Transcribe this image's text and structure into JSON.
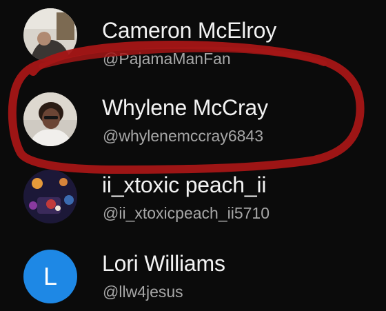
{
  "colors": {
    "background": "#0b0b0b",
    "name_text": "#f2f2f2",
    "handle_text": "#a7a7a7",
    "highlight_stroke": "#a51616",
    "letter_avatar": "#1e88e5"
  },
  "users": [
    {
      "name": "Cameron McElroy",
      "handle": "@PajamaManFan",
      "avatar": "photo"
    },
    {
      "name": "Whylene McCray",
      "handle": "@whylenemccray6843",
      "avatar": "photo"
    },
    {
      "name": "ii_xtoxic peach_ii",
      "handle": "@ii_xtoxicpeach_ii5710",
      "avatar": "photo"
    },
    {
      "name": "Lori Williams",
      "handle": "@llw4jesus",
      "avatar": "letter",
      "initial": "L"
    }
  ]
}
